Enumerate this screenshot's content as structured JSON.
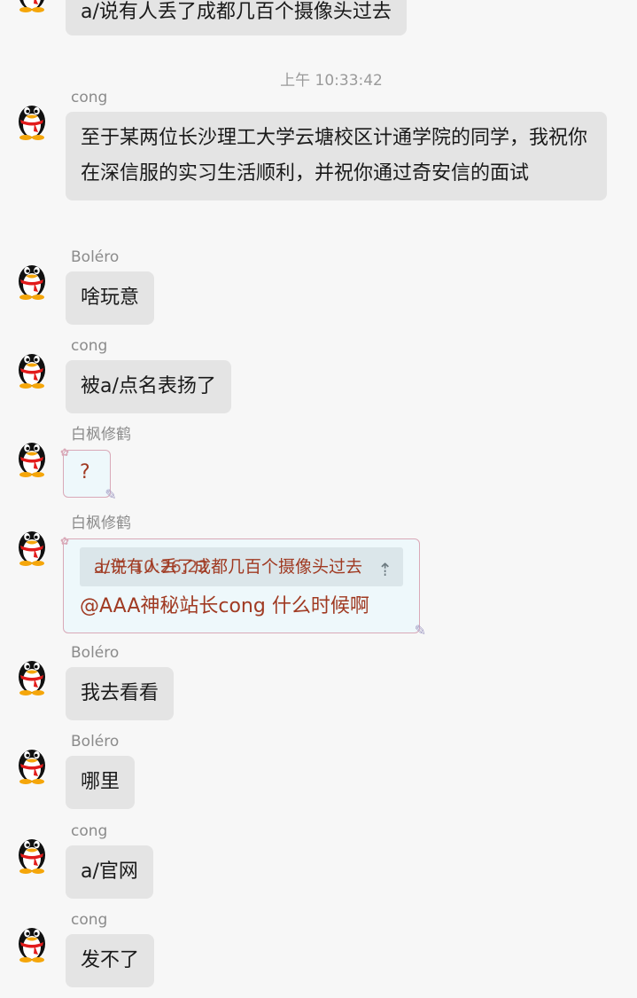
{
  "accent_color": "#e4e4e4",
  "timestamp": "上午 10:33:42",
  "top_message": {
    "text": "a/说有人丢了成都几百个摄像头过去"
  },
  "messages": [
    {
      "sender": "cong",
      "text": "至于某两位长沙理工大学云塘校区计通学院的同学，我祝你在深信服的实习生活顺利，并祝你通过奇安信的面试"
    },
    {
      "sender": "Boléro",
      "text": "啥玩意"
    },
    {
      "sender": "cong",
      "text": "被a/点名表扬了"
    },
    {
      "sender": "白枫修鹤",
      "text": "?"
    },
    {
      "sender": "白枫修鹤",
      "quote": "a/说有人丢了成都几百个摄像头过去",
      "quote_overlay": "上午 10:26:22",
      "text": "@AAA神秘站长cong 什么时候啊"
    },
    {
      "sender": "Boléro",
      "text": "我去看看"
    },
    {
      "sender": "Boléro",
      "text": "哪里"
    },
    {
      "sender": "cong",
      "text": "a/官网"
    },
    {
      "sender": "cong",
      "text": "发不了"
    }
  ]
}
